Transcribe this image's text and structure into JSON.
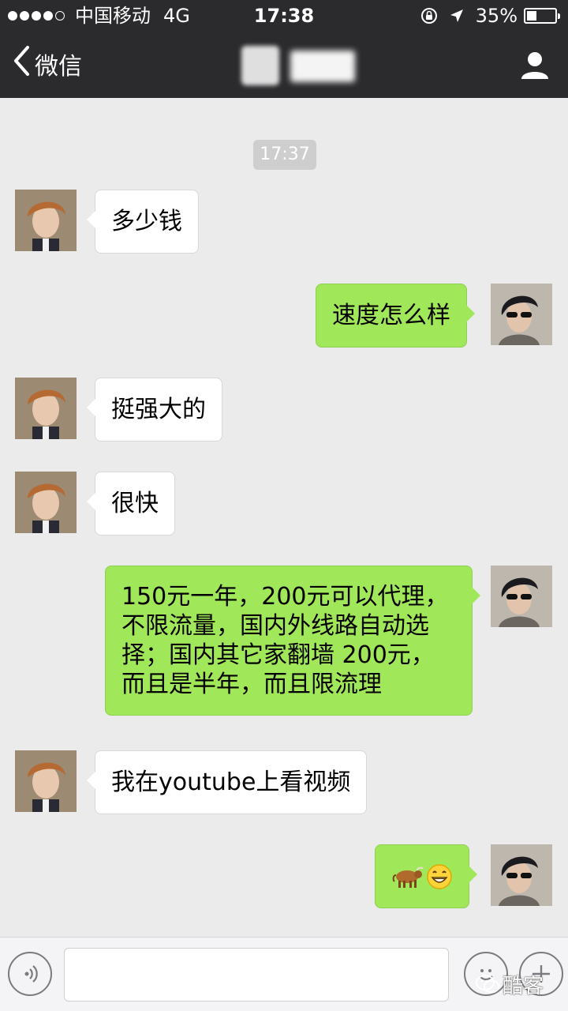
{
  "status_bar": {
    "carrier": "中国移动",
    "network": "4G",
    "time": "17:38",
    "battery": "35%",
    "battery_level": 0.35
  },
  "nav": {
    "back_label": "微信",
    "chat_name_redacted": true
  },
  "chat": {
    "timestamp": "17:37",
    "messages": [
      {
        "side": "in",
        "text": "多少钱"
      },
      {
        "side": "out",
        "text": "速度怎么样"
      },
      {
        "side": "in",
        "text": "挺强大的"
      },
      {
        "side": "in",
        "text": "很快"
      },
      {
        "side": "out",
        "lines": [
          "150元一年，200元可以代理，",
          "不限流量，国内外线路自动选",
          "择；国内其它家翻墙 200元，",
          "而且是半年，而且限流理"
        ]
      },
      {
        "side": "in",
        "text": "我在youtube上看视频"
      },
      {
        "side": "out",
        "emoji": [
          "ox-emoji",
          "grin-emoji"
        ]
      }
    ]
  },
  "input": {
    "placeholder": ""
  },
  "watermark": {
    "text": "酷客"
  },
  "colors": {
    "header_bg": "#2b2b2d",
    "chat_bg": "#ebebeb",
    "bubble_in": "#ffffff",
    "bubble_out": "#a0e75a",
    "timestamp_bg": "#cecece"
  }
}
